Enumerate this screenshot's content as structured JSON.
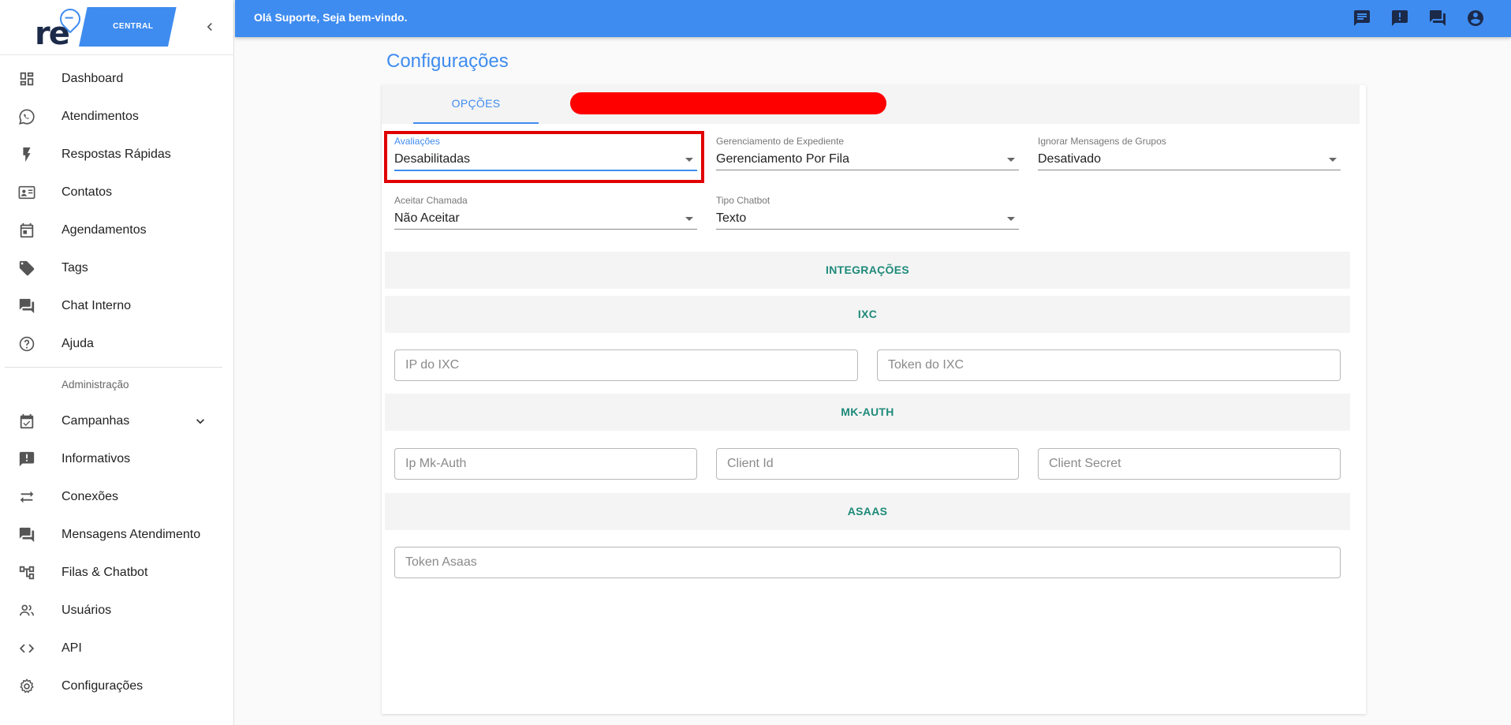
{
  "app": {
    "logo_text": "re",
    "logo_label": "CENTRAL",
    "greeting": "Olá Suporte, Seja bem-vindo."
  },
  "sidebar": {
    "items": [
      {
        "label": "Dashboard",
        "icon": "dashboard-icon"
      },
      {
        "label": "Atendimentos",
        "icon": "whatsapp-icon"
      },
      {
        "label": "Respostas Rápidas",
        "icon": "flash-icon"
      },
      {
        "label": "Contatos",
        "icon": "contact-card-icon"
      },
      {
        "label": "Agendamentos",
        "icon": "calendar-icon"
      },
      {
        "label": "Tags",
        "icon": "tag-icon"
      },
      {
        "label": "Chat Interno",
        "icon": "forum-icon"
      },
      {
        "label": "Ajuda",
        "icon": "help-icon"
      }
    ],
    "admin_header": "Administração",
    "admin_items": [
      {
        "label": "Campanhas",
        "icon": "event-available-icon"
      },
      {
        "label": "Informativos",
        "icon": "announcement-icon"
      },
      {
        "label": "Conexões",
        "icon": "sync-alt-icon"
      },
      {
        "label": "Mensagens Atendimento",
        "icon": "forum-icon"
      },
      {
        "label": "Filas & Chatbot",
        "icon": "account-tree-icon"
      },
      {
        "label": "Usuários",
        "icon": "people-icon"
      },
      {
        "label": "API",
        "icon": "code-icon"
      },
      {
        "label": "Configurações",
        "icon": "settings-icon"
      }
    ]
  },
  "page": {
    "title": "Configurações",
    "tab": "OPÇÕES"
  },
  "fields": {
    "avaliacoes": {
      "label": "Avaliações",
      "value": "Desabilitadas"
    },
    "expediente": {
      "label": "Gerenciamento de Expediente",
      "value": "Gerenciamento Por Fila"
    },
    "grupos": {
      "label": "Ignorar Mensagens de Grupos",
      "value": "Desativado"
    },
    "chamada": {
      "label": "Aceitar Chamada",
      "value": "Não Aceitar"
    },
    "chatbot": {
      "label": "Tipo Chatbot",
      "value": "Texto"
    }
  },
  "sections": {
    "integracoes": "INTEGRAÇÕES",
    "ixc": "IXC",
    "mkauth": "MK-AUTH",
    "asaas": "ASAAS"
  },
  "inputs": {
    "ixc_ip": {
      "placeholder": "IP do IXC",
      "value": ""
    },
    "ixc_token": {
      "placeholder": "Token do IXC",
      "value": ""
    },
    "mk_ip": {
      "placeholder": "Ip Mk-Auth",
      "value": ""
    },
    "mk_client_id": {
      "placeholder": "Client Id",
      "value": ""
    },
    "mk_client_secret": {
      "placeholder": "Client Secret",
      "value": ""
    },
    "asaas_token": {
      "placeholder": "Token Asaas",
      "value": ""
    }
  },
  "colors": {
    "primary": "#3f8cf0",
    "section_text": "#1e8a7a",
    "highlight": "#e00000"
  }
}
